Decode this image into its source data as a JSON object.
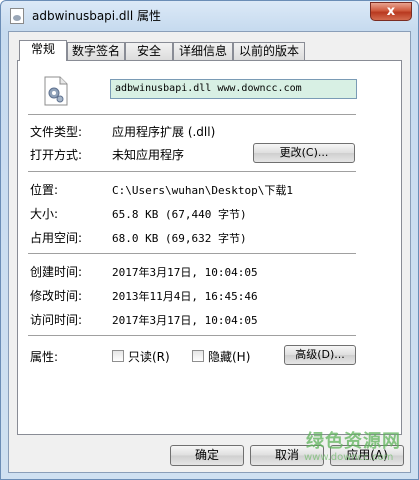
{
  "window": {
    "title": "adbwinusbapi.dll 属性",
    "close_label": "x"
  },
  "tabs": [
    {
      "label": "常规",
      "active": true
    },
    {
      "label": "数字签名",
      "active": false
    },
    {
      "label": "安全",
      "active": false
    },
    {
      "label": "详细信息",
      "active": false
    },
    {
      "label": "以前的版本",
      "active": false
    }
  ],
  "file": {
    "icon": "dll-file-icon",
    "name": "adbwinusbapi.dll  www.downcc.com"
  },
  "info": {
    "type_label": "文件类型:",
    "type_value": "应用程序扩展 (.dll)",
    "open_label": "打开方式:",
    "open_value": "未知应用程序",
    "change_button": "更改(C)...",
    "location_label": "位置:",
    "location_value": "C:\\Users\\wuhan\\Desktop\\下载1",
    "size_label": "大小:",
    "size_value": "65.8 KB (67,440 字节)",
    "disk_label": "占用空间:",
    "disk_value": "68.0 KB (69,632 字节)",
    "created_label": "创建时间:",
    "created_value": "2017年3月17日, 10:04:05",
    "modified_label": "修改时间:",
    "modified_value": "2013年11月4日, 16:45:46",
    "accessed_label": "访问时间:",
    "accessed_value": "2017年3月17日, 10:04:05",
    "attrs_label": "属性:",
    "readonly_label": "只读(R)",
    "hidden_label": "隐藏(H)",
    "advanced_button": "高级(D)..."
  },
  "buttons": {
    "ok": "确定",
    "cancel": "取消",
    "apply": "应用(A)"
  },
  "watermark": {
    "text": "绿色资源网",
    "url": "www.downcc.com"
  }
}
